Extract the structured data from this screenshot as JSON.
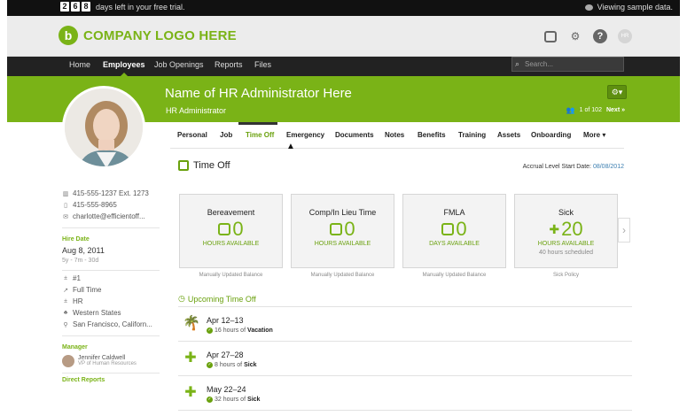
{
  "trial": {
    "digits": [
      "2",
      "6",
      "8"
    ],
    "text": "days left in your free trial.",
    "sample_notice": "Viewing sample data."
  },
  "header": {
    "logo_mark": "b",
    "logo_text": "COMPANY LOGO HERE",
    "avatar_initials": "HR"
  },
  "nav": {
    "items": [
      "Home",
      "Employees",
      "Job Openings",
      "Reports",
      "Files"
    ],
    "active": "Employees",
    "search_placeholder": "Search..."
  },
  "employee": {
    "name": "Name of HR Administrator Here",
    "title": "HR Administrator",
    "pager_text": "1 of 102",
    "next_label": "Next »"
  },
  "tabs": [
    "Personal",
    "Job",
    "Time Off",
    "Emergency",
    "Documents",
    "Notes",
    "Benefits",
    "Training",
    "Assets",
    "Onboarding",
    "More"
  ],
  "active_tab": "Time Off",
  "sidebar": {
    "phone_work": "415-555-1237 Ext. 1273",
    "phone_mobile": "415-555-8965",
    "email": "charlotte@efficientoff...",
    "hire_date_label": "Hire Date",
    "hire_date": "Aug 8, 2011",
    "tenure": "5y - 7m - 30d",
    "employee_number": "#1",
    "employment_status": "Full Time",
    "department": "HR",
    "division": "Western States",
    "location": "San Francisco, Californ...",
    "manager_label": "Manager",
    "manager_name": "Jennifer Caldwell",
    "manager_title": "VP of Human Resources",
    "direct_reports_label": "Direct Reports"
  },
  "time_off": {
    "title": "Time Off",
    "accrual_label": "Accrual Level Start Date:",
    "accrual_date": "08/08/2012",
    "cards": [
      {
        "name": "Bereavement",
        "value": "0",
        "unit": "HOURS AVAILABLE",
        "scheduled": "",
        "note": "Manually Updated Balance"
      },
      {
        "name": "Comp/In Lieu Time",
        "value": "0",
        "unit": "HOURS AVAILABLE",
        "scheduled": "",
        "note": "Manually Updated Balance"
      },
      {
        "name": "FMLA",
        "value": "0",
        "unit": "DAYS AVAILABLE",
        "scheduled": "",
        "note": "Manually Updated Balance"
      },
      {
        "name": "Sick",
        "value": "20",
        "unit": "HOURS AVAILABLE",
        "scheduled": "40 hours scheduled",
        "note": "Sick Policy"
      }
    ],
    "upcoming_title": "Upcoming Time Off",
    "upcoming": [
      {
        "date": "Apr 12–13",
        "hours": "16 hours of",
        "type": "Vacation",
        "icon": "palm-tree-icon"
      },
      {
        "date": "Apr 27–28",
        "hours": "8 hours of",
        "type": "Sick",
        "icon": "bandage-icon"
      },
      {
        "date": "May 22–24",
        "hours": "32 hours of",
        "type": "Sick",
        "icon": "bandage-icon"
      }
    ]
  },
  "colors": {
    "brand_green": "#7ab317",
    "nav_dark": "#222222",
    "link_blue": "#3c7fb1"
  }
}
